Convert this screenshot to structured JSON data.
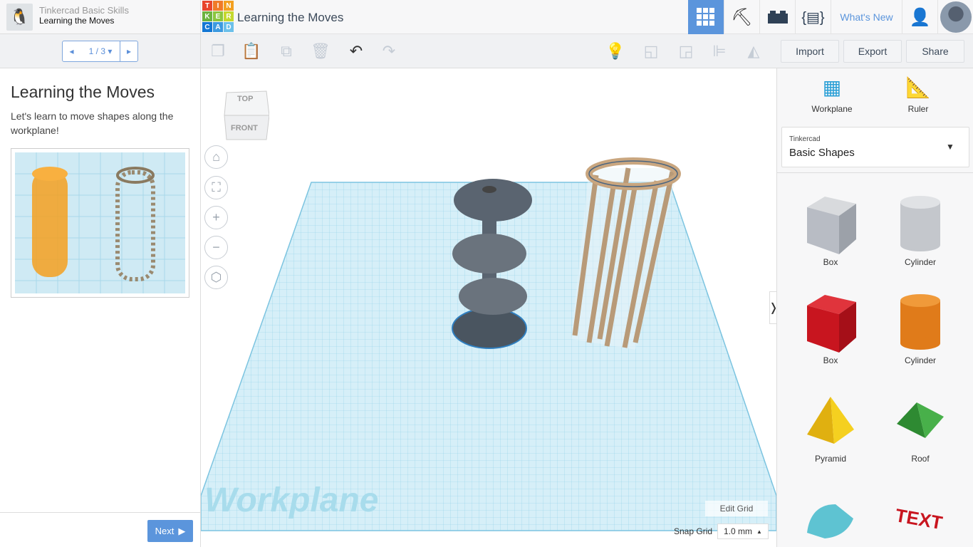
{
  "lesson_header": {
    "course": "Tinkercad Basic Skills",
    "lesson": "Learning the Moves"
  },
  "pager": {
    "current": "1 / 3"
  },
  "lesson": {
    "title": "Learning the Moves",
    "description": "Let's learn to move shapes along the workplane!",
    "next_label": "Next"
  },
  "header": {
    "logo_letters": [
      "T",
      "I",
      "N",
      "K",
      "E",
      "R",
      "C",
      "A",
      "D"
    ],
    "title": "Learning the Moves",
    "whats_new": "What's New",
    "accent": "#5b95dc"
  },
  "toolbar": {
    "import": "Import",
    "export": "Export",
    "share": "Share"
  },
  "viewcube": {
    "top": "TOP",
    "front": "FRONT"
  },
  "workplane": {
    "label": "Workplane",
    "edit_grid": "Edit Grid",
    "snap_grid_label": "Snap Grid",
    "snap_grid_value": "1.0 mm"
  },
  "right": {
    "workplane": "Workplane",
    "ruler": "Ruler",
    "library_source": "Tinkercad",
    "library": "Basic Shapes",
    "shapes": [
      {
        "label": "Box",
        "color": "#b8bcc4"
      },
      {
        "label": "Cylinder",
        "color": "#c4c7cc"
      },
      {
        "label": "Box",
        "color": "#d0202a"
      },
      {
        "label": "Cylinder",
        "color": "#e07b1a"
      },
      {
        "label": "Pyramid",
        "color": "#f0c419"
      },
      {
        "label": "Roof",
        "color": "#2e9a3a"
      }
    ]
  }
}
